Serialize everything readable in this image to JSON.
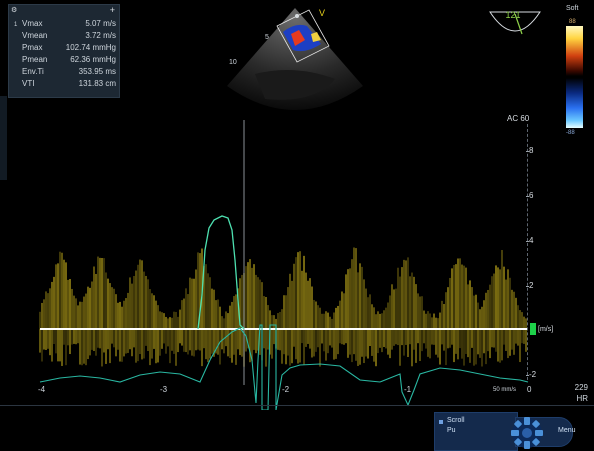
{
  "measurements": {
    "index": "1",
    "rows": [
      {
        "label": "Vmax",
        "value": "5.07 m/s"
      },
      {
        "label": "Vmean",
        "value": "3.72 m/s"
      },
      {
        "label": "Pmax",
        "value": "102.74 mmHg"
      },
      {
        "label": "Pmean",
        "value": "62.36 mmHg"
      },
      {
        "label": "Env.Ti",
        "value": "353.95 ms"
      },
      {
        "label": "VTI",
        "value": "131.83 cm"
      }
    ],
    "header_icon": "settings-icon",
    "add_icon": "+"
  },
  "image2d": {
    "marker_v": "V",
    "depth_5": "5",
    "depth_10": "10"
  },
  "probe_angle": "121",
  "color_map": {
    "label": "Soft",
    "top_value": "88",
    "bottom_value": "-88"
  },
  "preset": "AC 60",
  "velocity_axis": {
    "unit": "[m/s]",
    "ticks": [
      "8",
      "6",
      "4",
      "2",
      "-2"
    ]
  },
  "time_axis": {
    "labels": [
      "-4",
      "-3",
      "-2",
      "-1",
      "0"
    ],
    "sweep": "50 mm/s"
  },
  "heart_rate": {
    "value": "229",
    "unit": "HR"
  },
  "controls": {
    "scroll_label": "Scroll",
    "pu_label": "Pu",
    "menu_label": "Menu"
  },
  "colors": {
    "spectrum": "#c9b21c",
    "ecg": "#29b7a2",
    "envelope": "#4de0b0",
    "marker": "#1ed14a"
  }
}
